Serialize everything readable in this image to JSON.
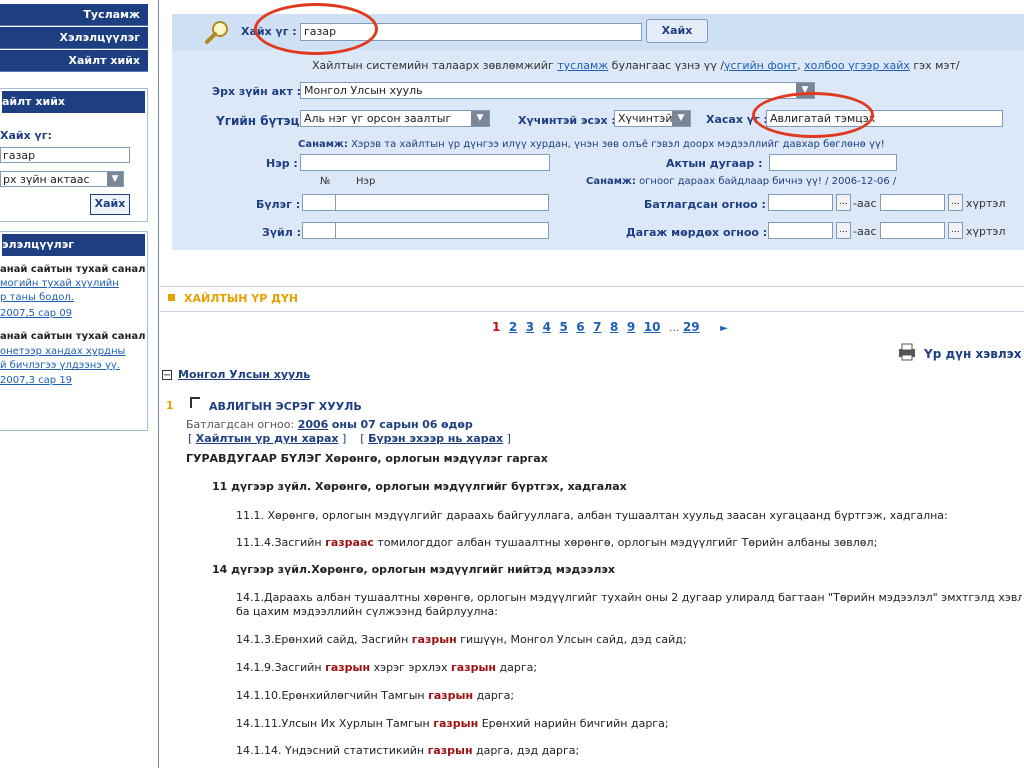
{
  "sidebar": {
    "nav": [
      "Тусламж",
      "Хэлэлцүүлэг",
      "Хайлт хийх"
    ],
    "search_panel": {
      "title": "айлт хийх",
      "keyword_label": "Хайх үг:",
      "keyword_value": "газар",
      "scope_value": "рх зүйн актаас",
      "button": "Хайх"
    },
    "discussion_panel": {
      "title": "элэлцүүлэг",
      "items": [
        {
          "title": "анай сайтын тухай санал",
          "line1": "могийн тухай хуулийн",
          "line2": "р таны бодол.",
          "date": "2007,5 сар 09"
        },
        {
          "title": "анай сайтын тухай санал",
          "line1": "онетээр хандах хурдны",
          "line2": "й бичлэгээ үлдээнэ үү.",
          "date": "2007,3 сар 19"
        }
      ]
    }
  },
  "search": {
    "keyword_label": "Хайх үг :",
    "keyword_value": "газар",
    "search_button": "Хайх",
    "help_text_pre": "Хайлтын системийн талаарх зөвлөмжийг",
    "help_link1": "тусламж",
    "help_text_mid": "булангаас үзнэ үү /",
    "help_link2": "үсгийн фонт",
    "help_link3": "холбоо үгээр хайх",
    "help_text_post": "гэх мэт/",
    "act_label": "Эрх зүйн акт :",
    "act_value": "Монгол Улсын хууль",
    "structure_label": "Үгийн бүтэц :",
    "structure_value": "Аль нэг үг орсон заалтыг",
    "validity_label": "Хүчинтэй эсэх :",
    "validity_value": "Хүчинтэй",
    "exclude_label": "Хасах үг :",
    "exclude_value": "Авлигатай тэмцэх",
    "note1_label": "Санамж:",
    "note1_text": "Хэрэв та хайлтын үр дүнгээ илүү хурдан, үнэн зөв олъё гэвэл доорх мэдээллийг давхар бөглөнө үү!",
    "name_label": "Нэр :",
    "act_number_label": "Актын дугаар :",
    "col_no": "№",
    "col_name": "Нэр",
    "note2_label": "Санамж:",
    "note2_text": "огноог дараах байдлаар бичнэ үү! / 2006-12-06 /",
    "chapter_label": "Бүлэг :",
    "article_label": "Зүйл :",
    "approved_label": "Батлагдсан огноо :",
    "effective_label": "Дагаж мөрдөх огноо :",
    "from_text": "-аас",
    "until_text": "хүртэл",
    "dots": "..."
  },
  "results": {
    "header": "ХАЙЛТЫН ҮР ДҮН",
    "pages": [
      "1",
      "2",
      "3",
      "4",
      "5",
      "6",
      "7",
      "8",
      "9",
      "10"
    ],
    "ellipsis": "...",
    "last_page": "29",
    "next": "►",
    "print_label": "Үр дүн хэвлэх",
    "group_label": "Монгол Улсын хууль",
    "item_number": "1",
    "item_title": "АВЛИГЫН ЭСРЭГ ХУУЛЬ",
    "approved_prefix": "Батлагдсан огноо:",
    "approved_year": "2006",
    "approved_mid": "оны",
    "approved_month": "07",
    "approved_mid2": "сарын",
    "approved_day": "06",
    "approved_suffix": "өдөр",
    "link1": "Хайлтын үр дүн харах",
    "link2": "Бүрэн эхээр нь харах",
    "chapter": "ГУРАВДУГААР БҮЛЭГ Хөрөнгө, орлогын мэдүүлэг гаргах",
    "art11": "11 дүгээр зүйл. Хөрөнгө, орлогын мэдүүлгийг бүртгэх, хадгалах",
    "p11_1": "11.1. Хөрөнгө, орлогын мэдүүлгийг дараахь байгууллага, албан тушаалтан хуульд заасан хугацаанд бүртгэж, хадгална:",
    "p11_1_4_pre": "11.1.4.Засгийн",
    "p11_1_4_hl": "газраас",
    "p11_1_4_post": "томилогддог албан тушаалтны хөрөнгө, орлогын мэдүүлгийг Төрийн албаны зөвлөл;",
    "art14": "14 дүгээр зүйл.Хөрөнгө, орлогын мэдүүлгийг нийтэд мэдээлэх",
    "p14_1_a": "14.1.Дараахь албан тушаалтны хөрөнгө, орлогын мэдүүлгийг тухайн оны 2 дугаар улиралд багтаан \"Төрийн мэдээлэл\" эмхтгэлд хэвлэн нийтлэх",
    "p14_1_b": "ба цахим мэдээллийн сүлжээнд байрлуулна:",
    "p14_1_3_pre": "14.1.3.Ерөнхий сайд, Засгийн",
    "p14_1_3_hl": "газрын",
    "p14_1_3_post": "гишүүн, Монгол Улсын сайд, дэд сайд;",
    "p14_1_9_pre": "14.1.9.Засгийн",
    "p14_1_9_hl1": "газрын",
    "p14_1_9_mid": "хэрэг эрхлэх",
    "p14_1_9_hl2": "газрын",
    "p14_1_9_post": "дарга;",
    "p14_1_10_pre": "14.1.10.Ерөнхийлөгчийн Тамгын",
    "p14_1_10_hl": "газрын",
    "p14_1_10_post": "дарга;",
    "p14_1_11_pre": "14.1.11.Улсын Их Хурлын Тамгын",
    "p14_1_11_hl": "газрын",
    "p14_1_11_post": "Ерөнхий нарийн бичгийн дарга;",
    "p14_1_14_pre": "14.1.14. Үндэсний статистикийн",
    "p14_1_14_hl": "газрын",
    "p14_1_14_post": "дарга, дэд дарга;"
  },
  "colors": {
    "navy": "#1d3f82",
    "link": "#1d5fb5",
    "highlight": "#9b1010",
    "annotation": "#e0391e",
    "results_header": "#e8a000"
  }
}
